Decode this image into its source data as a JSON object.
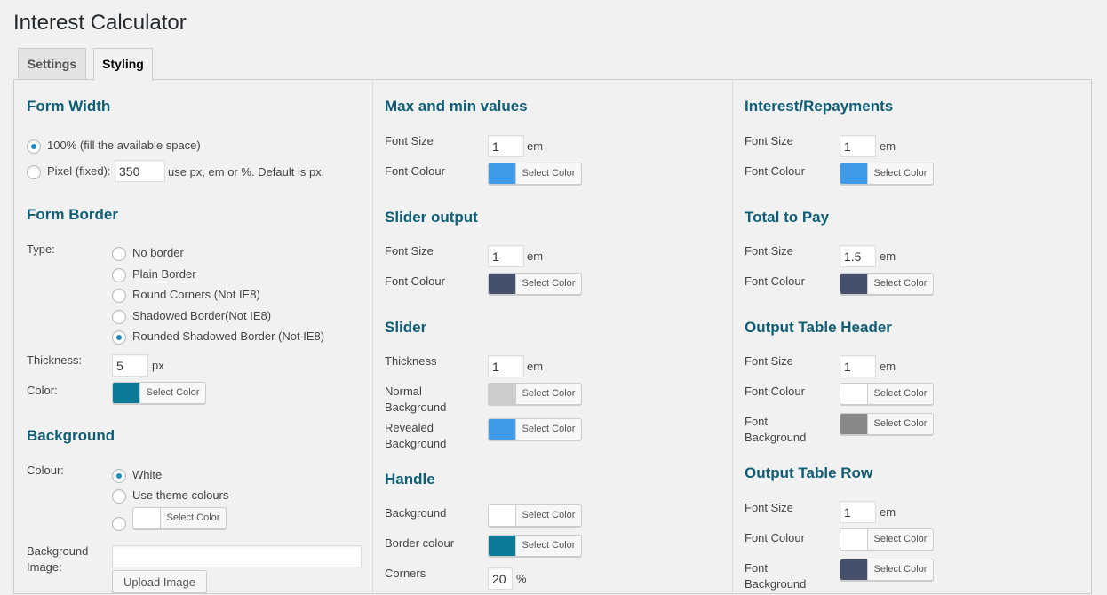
{
  "page": {
    "title": "Interest Calculator"
  },
  "tabs": {
    "settings": "Settings",
    "styling": "Styling"
  },
  "common": {
    "font_size": "Font Size",
    "font_colour": "Font Colour",
    "select_color": "Select Color",
    "em": "em"
  },
  "colors": {
    "blue": "#3f9be8",
    "slate": "#46506a",
    "teal": "#0b7b98",
    "white": "#ffffff",
    "light_gray": "#cccccc",
    "gray": "#888888"
  },
  "form_width": {
    "title": "Form Width",
    "option_full": "100% (fill the available space)",
    "option_pixel": "Pixel (fixed):",
    "pixel_value": "350",
    "pixel_note": "use px, em or %. Default is px."
  },
  "form_border": {
    "title": "Form Border",
    "type_label": "Type:",
    "options": [
      "No border",
      "Plain Border",
      "Round Corners (Not IE8)",
      "Shadowed Border(Not IE8)",
      "Rounded Shadowed Border (Not IE8)"
    ],
    "selected_index": 4,
    "thickness_label": "Thickness:",
    "thickness_value": "5",
    "thickness_unit": "px",
    "color_label": "Color:"
  },
  "background": {
    "title": "Background",
    "colour_label": "Colour:",
    "options": [
      "White",
      "Use theme colours"
    ],
    "image_label_1": "Background",
    "image_label_2": "Image:",
    "upload_button": "Upload Image"
  },
  "max_min": {
    "title": "Max and min values",
    "font_size": "1"
  },
  "slider_output": {
    "title": "Slider output",
    "font_size": "1"
  },
  "slider": {
    "title": "Slider",
    "thickness_label": "Thickness",
    "thickness_value": "1",
    "normal_bg_1": "Normal",
    "normal_bg_2": "Background",
    "revealed_bg_1": "Revealed",
    "revealed_bg_2": "Background"
  },
  "handle": {
    "title": "Handle",
    "background_label": "Background",
    "border_label": "Border colour",
    "corners_label": "Corners",
    "corners_value": "20",
    "corners_unit": "%"
  },
  "interest": {
    "title": "Interest/Repayments",
    "font_size": "1"
  },
  "total": {
    "title": "Total to Pay",
    "font_size": "1.5"
  },
  "table_header": {
    "title": "Output Table Header",
    "font_size": "1",
    "font_bg_1": "Font",
    "font_bg_2": "Background"
  },
  "table_row": {
    "title": "Output Table Row",
    "font_size": "1",
    "font_bg_1": "Font",
    "font_bg_2": "Background"
  }
}
